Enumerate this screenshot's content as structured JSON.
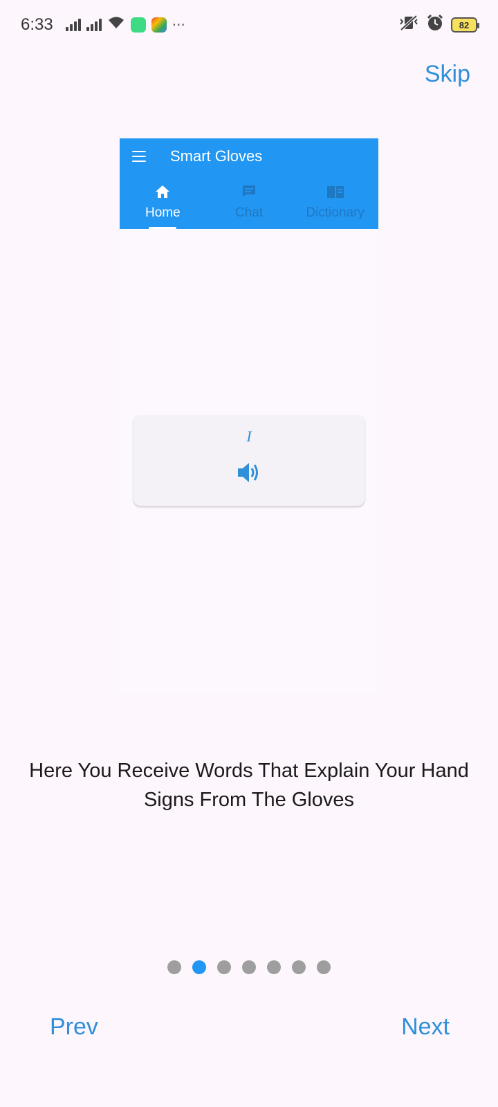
{
  "status_bar": {
    "time": "6:33",
    "battery": "82"
  },
  "skip_label": "Skip",
  "preview": {
    "app_title": "Smart Gloves",
    "tabs": [
      {
        "label": "Home",
        "icon": "home-icon",
        "active": true
      },
      {
        "label": "Chat",
        "icon": "chat-icon",
        "active": false
      },
      {
        "label": "Dictionary",
        "icon": "book-icon",
        "active": false
      }
    ],
    "word_card": {
      "word": "I",
      "speaker_icon": "speaker-icon"
    },
    "colors": {
      "appbar": "#2196f3",
      "accent": "#2f8fd8"
    }
  },
  "description": "Here You  Receive Words That Explain Your Hand Signs From The Gloves",
  "pagination": {
    "total": 7,
    "current": 2
  },
  "nav": {
    "prev_label": "Prev",
    "next_label": "Next"
  }
}
